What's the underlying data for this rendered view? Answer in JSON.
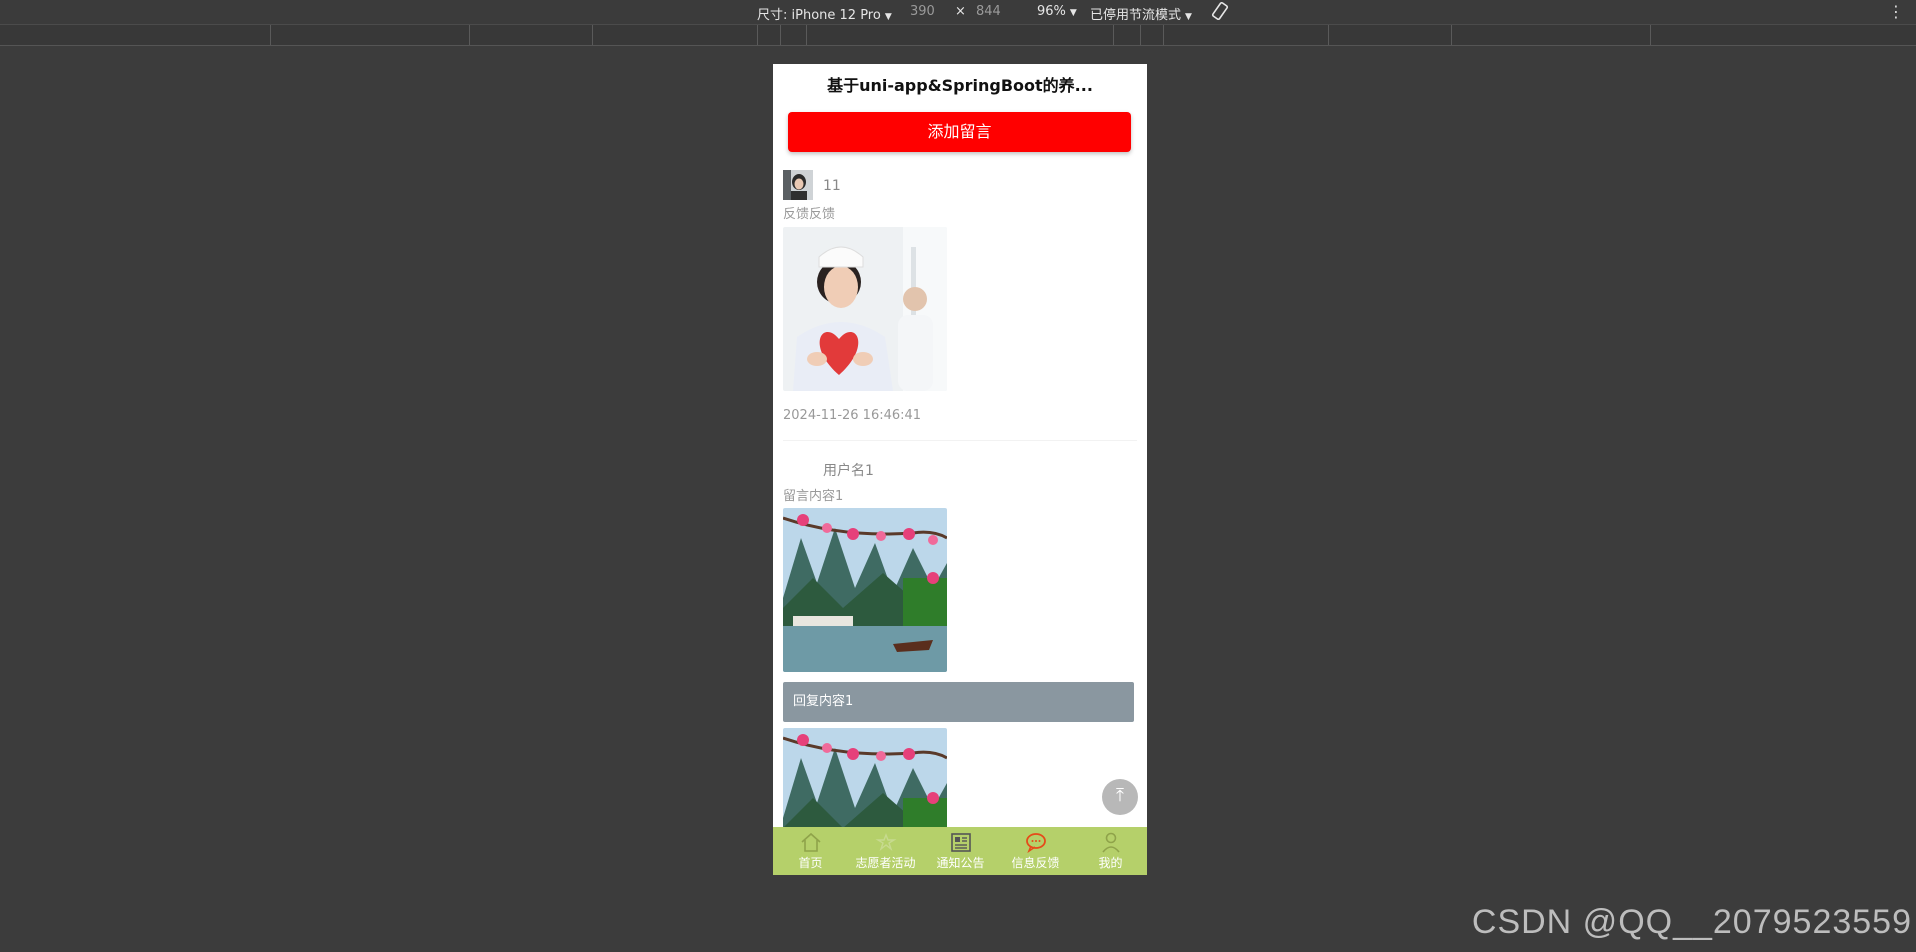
{
  "devtools": {
    "device_label": "尺寸: iPhone 12 Pro",
    "width": "390",
    "times": "×",
    "height": "844",
    "zoom": "96%",
    "throttle": "已停用节流模式"
  },
  "app": {
    "title": "基于uni-app&SpringBoot的养...",
    "add_button": "添加留言"
  },
  "messages": [
    {
      "username": "11",
      "content": "反馈反馈",
      "time": "2024-11-26 16:46:41"
    },
    {
      "username": "用户名1",
      "content": "留言内容1",
      "reply": "回复内容1"
    }
  ],
  "tabbar": {
    "items": [
      {
        "label": "首页",
        "icon": "home-icon"
      },
      {
        "label": "志愿者活动",
        "icon": "activity-icon"
      },
      {
        "label": "通知公告",
        "icon": "news-icon"
      },
      {
        "label": "信息反馈",
        "icon": "chat-icon",
        "active": true
      },
      {
        "label": "我的",
        "icon": "user-icon"
      }
    ],
    "background": "#b5d06a",
    "active_color": "#e64a19"
  },
  "watermark": "CSDN @QQ__2079523559"
}
